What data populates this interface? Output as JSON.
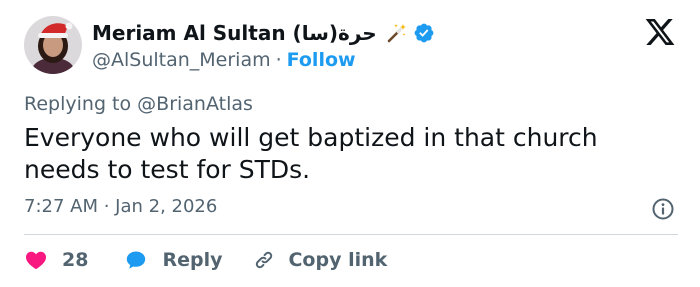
{
  "author": {
    "display_name": "Meriam Al Sultan (سا)حرة",
    "handle": "@AlSultan_Meriam",
    "separator": "·",
    "follow_label": "Follow",
    "avatar_icon": "avatar-santa-hat",
    "badge_icon": "magic-wand-icon",
    "verified_icon": "verified-badge-icon"
  },
  "tweet": {
    "replying_to": "Replying to @BrianAtlas",
    "text": "Everyone who will get baptized in that church needs to test for STDs.",
    "timestamp": "7:27 AM · Jan 2, 2026"
  },
  "actions": {
    "like_count": "28",
    "reply_label": "Reply",
    "copy_label": "Copy link"
  },
  "colors": {
    "text": "#0f1419",
    "secondary": "#536471",
    "accent": "#1d9bf0",
    "like": "#f91880",
    "divider": "#cfd9de"
  },
  "icons": {
    "platform": "x-logo-icon",
    "info": "info-icon",
    "like": "heart-icon",
    "reply": "speech-bubble-icon",
    "copy": "link-icon"
  }
}
